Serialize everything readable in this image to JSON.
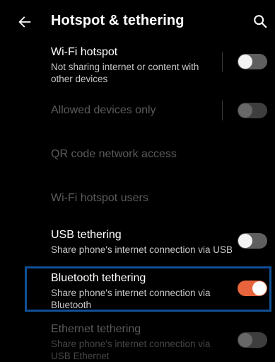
{
  "appbar": {
    "title": "Hotspot & tethering",
    "back_icon": "arrow-left-icon",
    "search_icon": "search-icon"
  },
  "settings": {
    "wifi_hotspot": {
      "title": "Wi-Fi hotspot",
      "subtitle": "Not sharing internet or content with other devices",
      "enabled": true,
      "checked": false
    },
    "allowed_devices": {
      "title": "Allowed devices only",
      "enabled": false,
      "checked": false
    },
    "qr_access": {
      "title": "QR code network access",
      "enabled": false
    },
    "hotspot_users": {
      "title": "Wi-Fi hotspot users",
      "enabled": false
    },
    "usb_tethering": {
      "title": "USB tethering",
      "subtitle": "Share phone's internet connection via USB",
      "enabled": true,
      "checked": false
    },
    "bluetooth_tethering": {
      "title": "Bluetooth tethering",
      "subtitle": "Share phone's internet connection via Bluetooth",
      "enabled": true,
      "checked": true,
      "highlighted": true
    },
    "ethernet_tethering": {
      "title": "Ethernet tethering",
      "subtitle": "Share phone's internet connection via USB Ethernet",
      "enabled": false,
      "checked": false
    }
  },
  "colors": {
    "accent": "#e8643c",
    "highlight_border": "#0f4f96",
    "background": "#000000"
  }
}
